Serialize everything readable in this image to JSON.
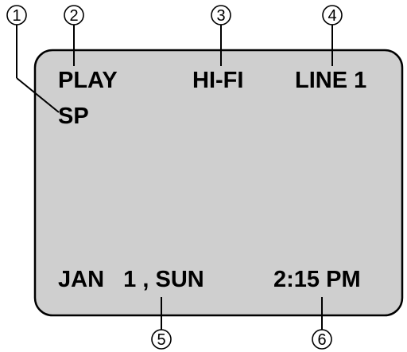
{
  "screen": {
    "background": "#cfcfcf",
    "border": "#000000",
    "mode": "PLAY",
    "audio": "HI-FI",
    "input": "LINE 1",
    "speed": "SP",
    "date": "JAN   1 , SUN",
    "time": "2:15 PM"
  },
  "callouts": [
    {
      "number": "1"
    },
    {
      "number": "2"
    },
    {
      "number": "3"
    },
    {
      "number": "4"
    },
    {
      "number": "5"
    },
    {
      "number": "6"
    }
  ]
}
